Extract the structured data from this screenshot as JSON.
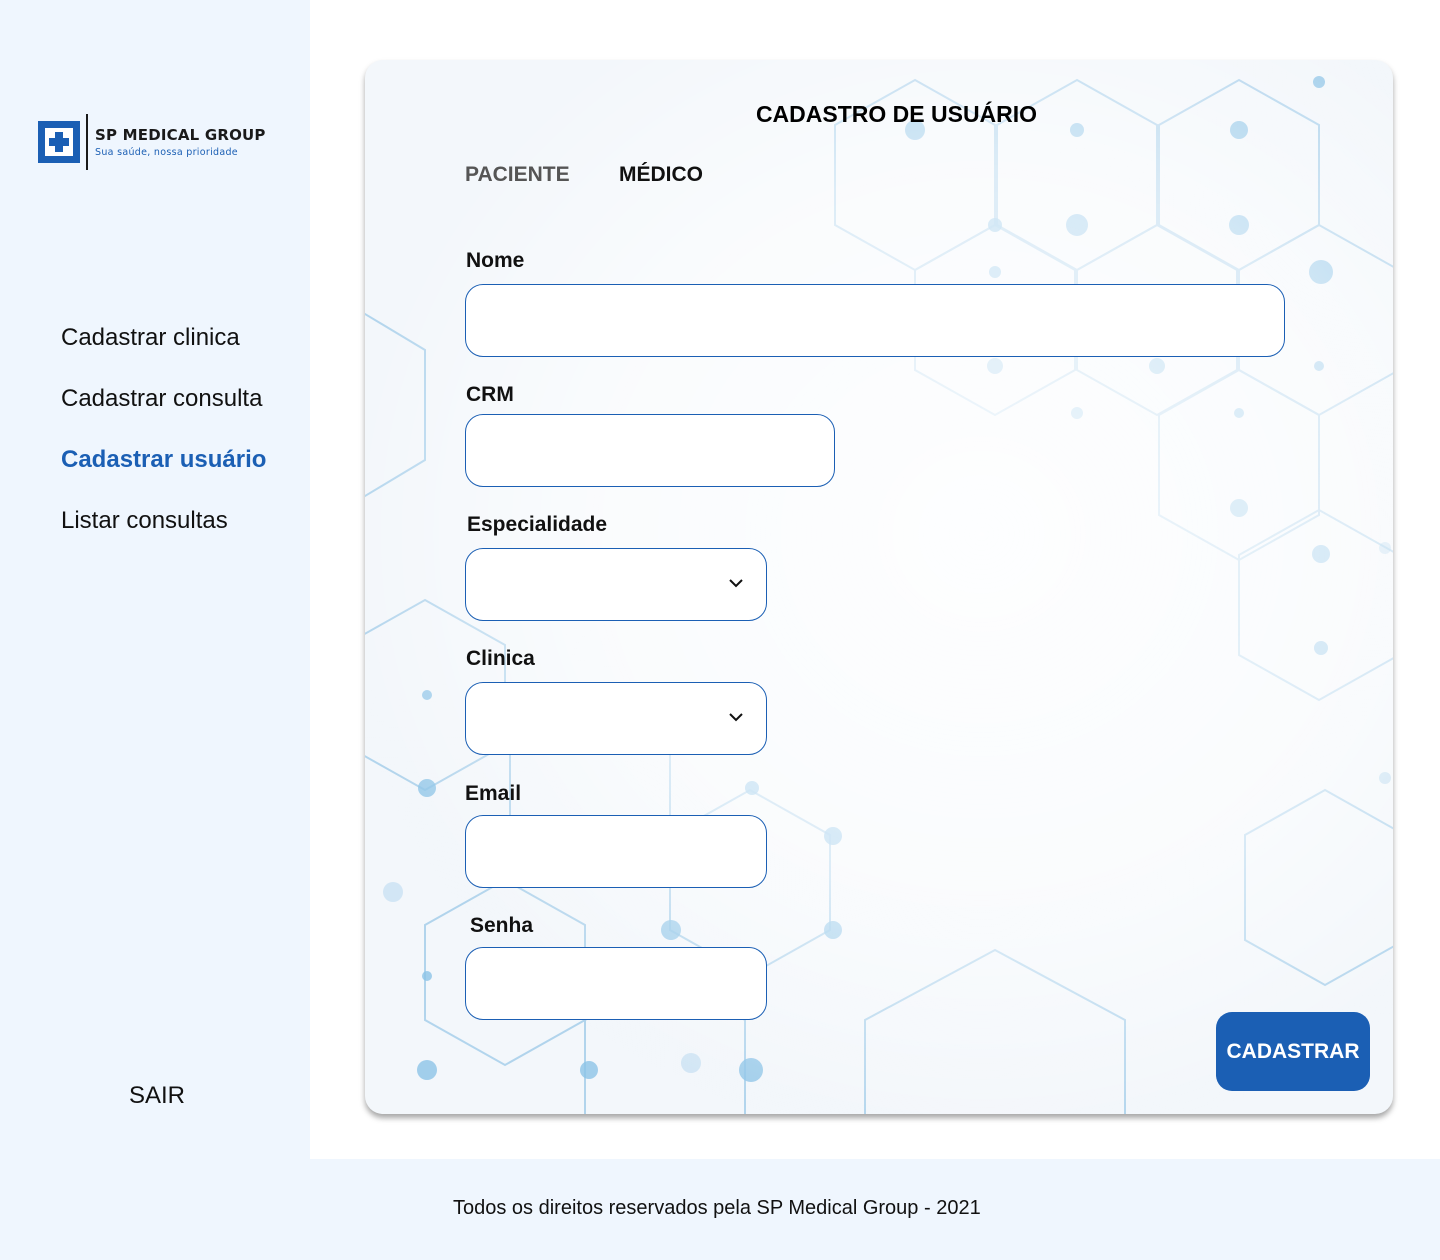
{
  "brand": {
    "name": "SP MEDICAL GROUP",
    "tagline": "Sua saúde, nossa prioridade",
    "accent_color": "#1b5fb4",
    "logo_icon": "medical-cross-icon"
  },
  "sidebar": {
    "items": [
      {
        "label": "Cadastrar clinica",
        "active": false
      },
      {
        "label": "Cadastrar consulta",
        "active": false
      },
      {
        "label": "Cadastrar usuário",
        "active": true
      },
      {
        "label": "Listar consultas",
        "active": false
      }
    ],
    "logout_label": "SAIR"
  },
  "form": {
    "title": "CADASTRO DE USUÁRIO",
    "tabs": [
      {
        "label": "PACIENTE",
        "selected": false
      },
      {
        "label": "MÉDICO",
        "selected": true
      }
    ],
    "fields": {
      "nome": {
        "label": "Nome",
        "value": ""
      },
      "crm": {
        "label": "CRM",
        "value": ""
      },
      "especialidade": {
        "label": "Especialidade",
        "selected": "",
        "icon": "chevron-down-icon"
      },
      "clinica": {
        "label": "Clinica",
        "selected": "",
        "icon": "chevron-down-icon"
      },
      "email": {
        "label": "Email",
        "value": ""
      },
      "senha": {
        "label": "Senha",
        "value": ""
      }
    },
    "submit_label": "CADASTRAR"
  },
  "footer": {
    "text": "Todos os direitos reservados pela SP Medical Group - 2021"
  }
}
